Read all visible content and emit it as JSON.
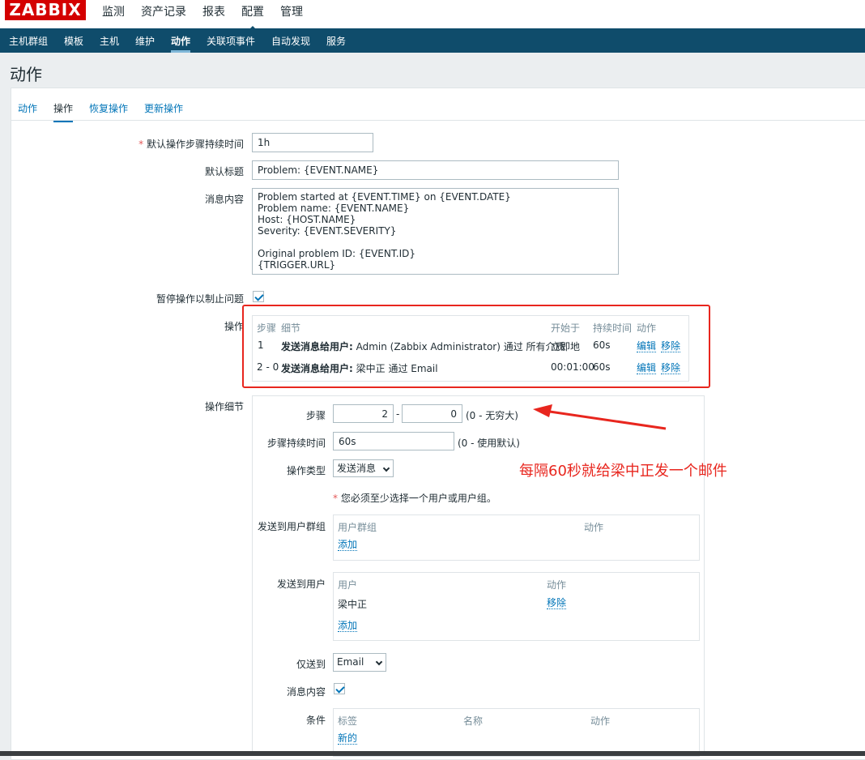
{
  "header": {
    "logo": "ZABBIX",
    "main_menu": [
      "监测",
      "资产记录",
      "报表",
      "配置",
      "管理"
    ],
    "sub_menu": [
      "主机群组",
      "模板",
      "主机",
      "维护",
      "动作",
      "关联项事件",
      "自动发现",
      "服务"
    ]
  },
  "page_title": "动作",
  "tabs": [
    "动作",
    "操作",
    "恢复操作",
    "更新操作"
  ],
  "form": {
    "default_step_label": "默认操作步骤持续时间",
    "default_step_value": "1h",
    "default_subject_label": "默认标题",
    "default_subject_value": "Problem: {EVENT.NAME}",
    "message_label": "消息内容",
    "message_lines": [
      "Problem started at {EVENT.TIME} on {EVENT.DATE}",
      "Problem name: {EVENT.NAME}",
      "Host: {HOST.NAME}",
      "Severity: {EVENT.SEVERITY}",
      "",
      "Original problem ID: {EVENT.ID}",
      "{TRIGGER.URL}"
    ],
    "pause_label": "暂停操作以制止问题",
    "pause_checked": true,
    "operations_label": "操作"
  },
  "operations_table": {
    "headers": [
      "步骤",
      "细节",
      "开始于",
      "持续时间",
      "动作"
    ],
    "rows": [
      {
        "step": "1",
        "detail_bold": "发送消息给用户:",
        "detail": " Admin (Zabbix Administrator) 通过 所有介质",
        "start": "立即地",
        "duration": "60s",
        "edit": "编辑",
        "remove": "移除"
      },
      {
        "step": "2 - 0",
        "detail_bold": "发送消息给用户:",
        "detail": " 梁中正 通过 Email",
        "start": "00:01:00",
        "duration": "60s",
        "edit": "编辑",
        "remove": "移除"
      }
    ]
  },
  "op_details": {
    "label": "操作细节",
    "step_label": "步骤",
    "step_from": "2",
    "step_sep": "-",
    "step_to": "0",
    "step_hint": "(0 - 无穷大)",
    "duration_label": "步骤持续时间",
    "duration_value": "60s",
    "duration_hint": "(0 - 使用默认)",
    "optype_label": "操作类型",
    "optype_value": "发送消息",
    "warning_star": "*",
    "warning": "您必须至少选择一个用户或用户组。",
    "send_groups_label": "发送到用户群组",
    "groups_headers": [
      "用户群组",
      "动作"
    ],
    "groups_add": "添加",
    "send_users_label": "发送到用户",
    "users_headers": [
      "用户",
      "动作"
    ],
    "users_rows": [
      {
        "name": "梁中正",
        "remove": "移除"
      }
    ],
    "users_add": "添加",
    "only_to_label": "仅送到",
    "only_to_value": "Email",
    "message_label": "消息内容",
    "message_checked": true,
    "conditions_label": "条件",
    "conditions_headers": [
      "标签",
      "名称",
      "动作"
    ],
    "conditions_new": "新的"
  },
  "annotation": "每隔60秒就给梁中正发一个邮件",
  "colors": {
    "brand": "#d40000",
    "nav": "#0f4c6b",
    "link": "#0275b8",
    "annotation": "#e8261e"
  }
}
